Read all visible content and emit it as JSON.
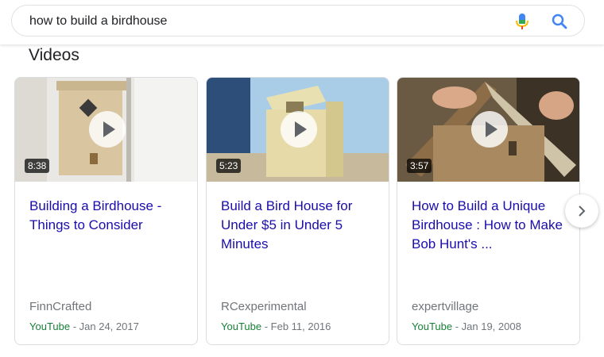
{
  "search": {
    "query": "how to build a birdhouse",
    "mic_icon": "microphone-icon",
    "search_icon": "search-icon"
  },
  "section": {
    "title": "Videos"
  },
  "videos": [
    {
      "duration": "8:38",
      "title": "Building a Birdhouse - Things to Consider",
      "channel": "FinnCrafted",
      "source": "YouTube",
      "date": " - Jan 24, 2017"
    },
    {
      "duration": "5:23",
      "title": "Build a Bird House for Under $5 in Under 5 Minutes",
      "channel": "RCexperimental",
      "source": "YouTube",
      "date": " - Feb 11, 2016"
    },
    {
      "duration": "3:57",
      "title": "How to Build a Unique Birdhouse : How to Make Bob Hunt's ...",
      "channel": "expertvillage",
      "source": "YouTube",
      "date": " - Jan 19, 2008"
    }
  ],
  "carousel": {
    "next_icon": "chevron-right-icon"
  },
  "colors": {
    "link": "#1a0dab",
    "source": "#188038",
    "meta": "#70757a",
    "mic_blue": "#4285f4",
    "mic_red": "#ea4335"
  }
}
